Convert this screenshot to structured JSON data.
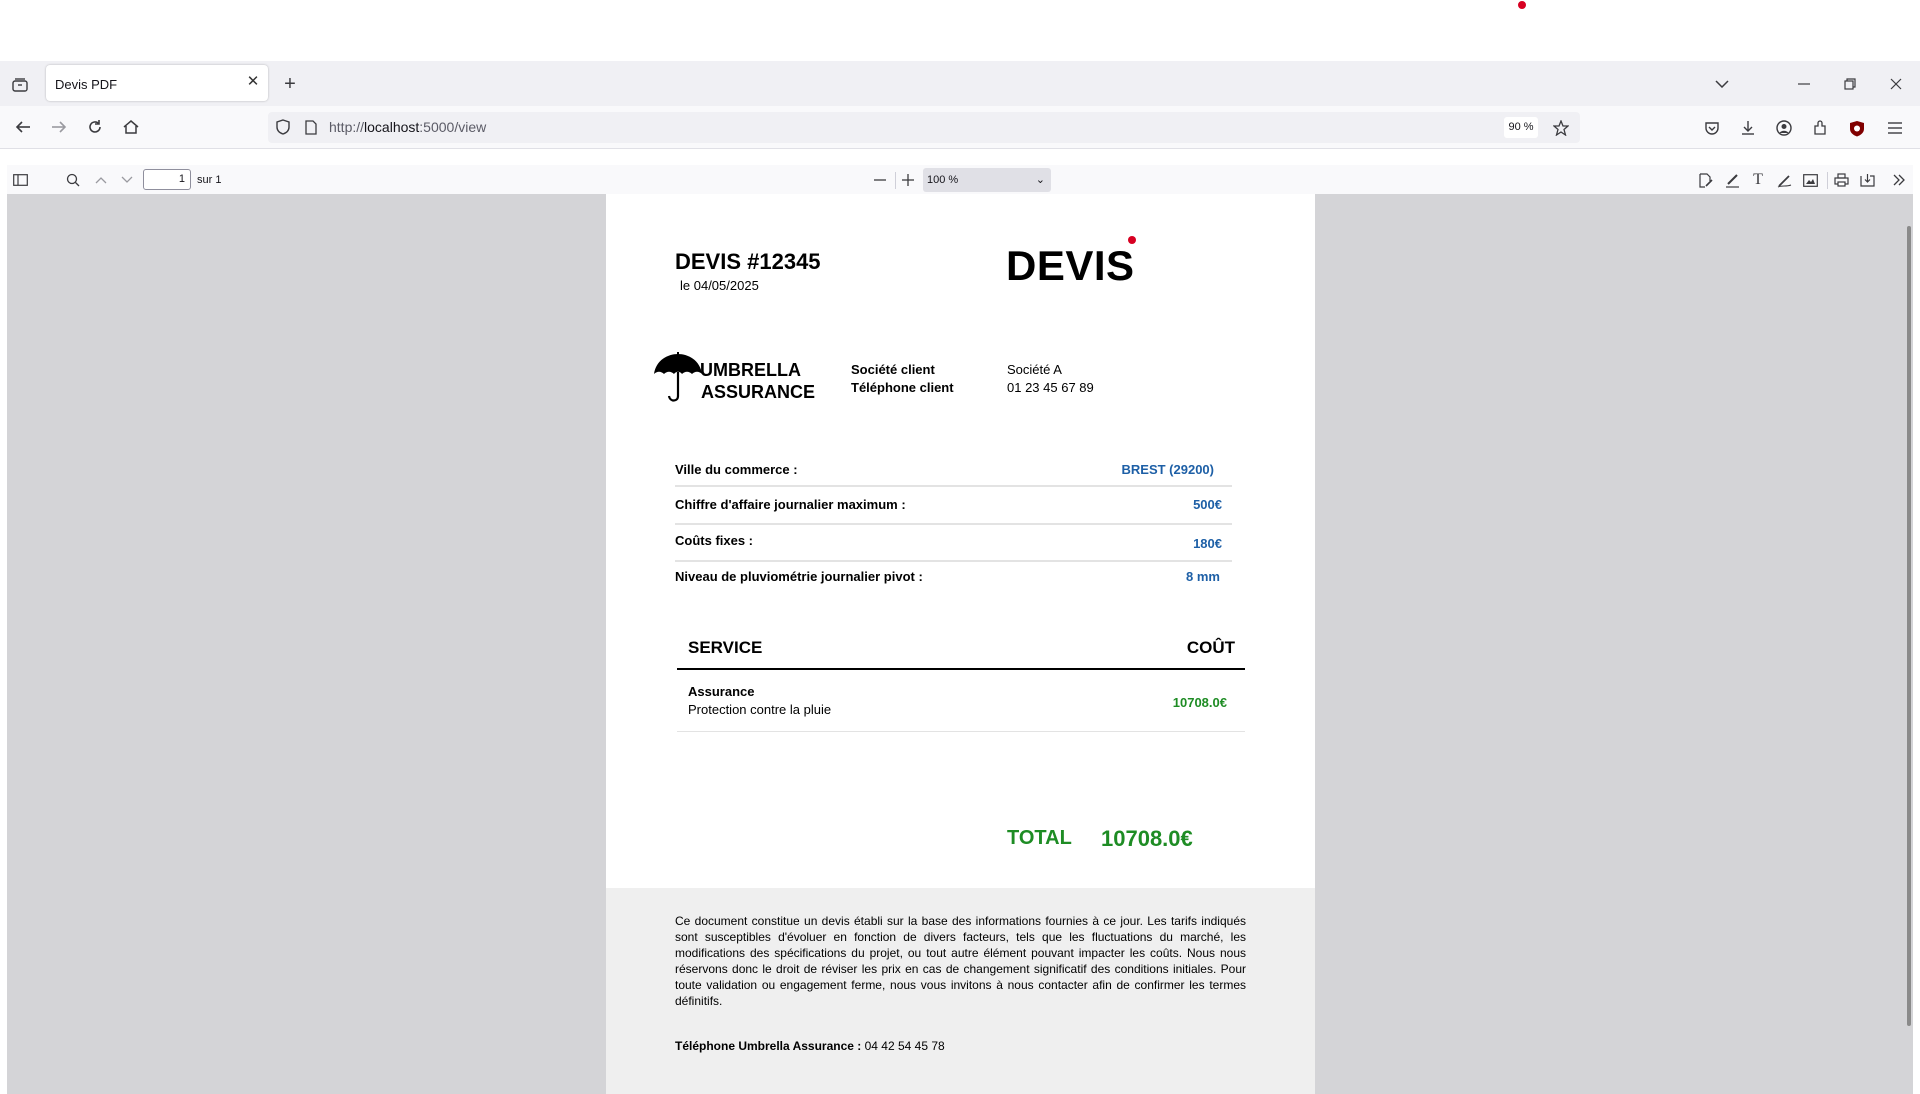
{
  "browser": {
    "tab_title": "Devis PDF",
    "url_scheme": "http://",
    "url_host": "localhost",
    "url_path": ":5000/view",
    "zoom_badge": "90 %"
  },
  "viewer": {
    "current_page": "1",
    "page_count_label": "sur 1",
    "zoom_value": "100 %"
  },
  "document": {
    "title": "DEVIS #12345",
    "date": "le 04/05/2025",
    "big_label": "DEVIS",
    "company": {
      "line1": "UMBRELLA",
      "line2": "ASSURANCE"
    },
    "client": {
      "company_label": "Société client",
      "company_value": "Société A",
      "phone_label": "Téléphone client",
      "phone_value": "01 23 45 67 89"
    },
    "info_rows": [
      {
        "label": "Ville du commerce :",
        "value": "BREST (29200)"
      },
      {
        "label": "Chiffre d'affaire journalier maximum :",
        "value": "500€"
      },
      {
        "label": "Coûts fixes :",
        "value": "180€"
      },
      {
        "label": "Niveau de pluviométrie journalier pivot :",
        "value": "8 mm"
      }
    ],
    "services": {
      "header_service": "SERVICE",
      "header_cost": "COÛT",
      "rows": [
        {
          "name": "Assurance",
          "description": "Protection contre la pluie",
          "cost": "10708.0€"
        }
      ]
    },
    "total_label": "TOTAL",
    "total_value": "10708.0€",
    "footer_text": "Ce document constitue un devis établi sur la base des informations fournies à ce jour. Les tarifs indiqués sont susceptibles d'évoluer en fonction de divers facteurs, tels que les fluctuations du marché, les modifications des spécifications du projet, ou tout autre élément pouvant impacter les coûts. Nous nous réservons donc le droit de réviser les prix en cas de changement significatif des conditions initiales. Pour toute validation ou engagement ferme, nous vous invitons à nous contacter afin de confirmer les termes définitifs.",
    "footer_phone_label": "Téléphone Umbrella Assurance :",
    "footer_phone_value": "04 42 54 45 78"
  },
  "colors": {
    "value_blue": "#1d5fa6",
    "total_green": "#1e8c24",
    "viewer_bg": "#d4d4d7"
  }
}
